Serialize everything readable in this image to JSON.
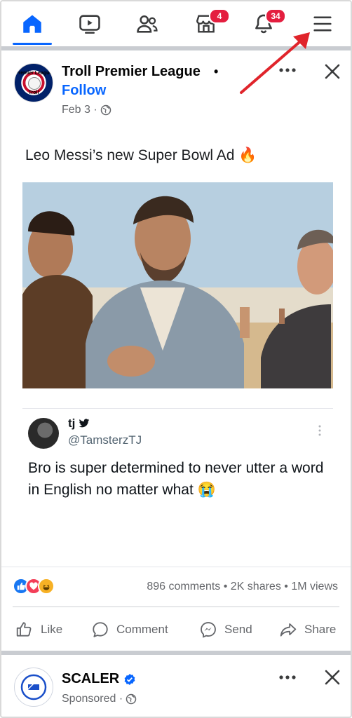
{
  "nav": {
    "items": [
      {
        "name": "home",
        "badge": ""
      },
      {
        "name": "video",
        "badge": ""
      },
      {
        "name": "friends",
        "badge": ""
      },
      {
        "name": "marketplace",
        "badge": "4"
      },
      {
        "name": "notifications",
        "badge": "34"
      },
      {
        "name": "menu",
        "badge": ""
      }
    ],
    "accent": "#0866ff",
    "badge_color": "#e41e3f"
  },
  "post": {
    "page_name": "Troll Premier League",
    "separator": "•",
    "follow_label": "Follow",
    "date": "Feb 3 ·",
    "text": "Leo Messi’s new Super Bowl Ad 🔥",
    "avatar_text_top": "Premier League",
    "avatar_text_bottom": "Troll"
  },
  "tweet": {
    "name": "tj",
    "handle": "@TamsterzTJ",
    "text": "Bro is super determined to never utter a word in English no matter what 😭"
  },
  "engagement": {
    "reaction_icons": [
      "like-reaction-icon",
      "love-reaction-icon",
      "haha-reaction-icon"
    ],
    "stats": "896 comments • 2K shares • 1M views"
  },
  "actions": {
    "like": "Like",
    "comment": "Comment",
    "send": "Send",
    "share": "Share"
  },
  "sponsored": {
    "name": "SCALER",
    "meta": "Sponsored ·"
  },
  "annotation_color": "#e0242b"
}
